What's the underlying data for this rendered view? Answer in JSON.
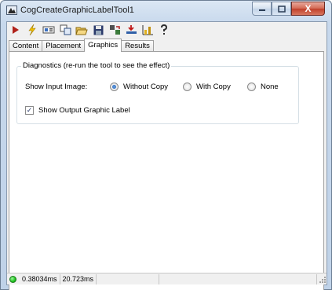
{
  "window": {
    "title": "CogCreateGraphicLabelTool1",
    "minimize_icon": "minimize-icon",
    "maximize_icon": "maximize-icon",
    "close_label": "X"
  },
  "toolbar": {
    "items": [
      "run-icon",
      "run-continuous-icon",
      "display-icon",
      "copy-icon",
      "open-icon",
      "save-icon",
      "reset-icon",
      "import-icon",
      "chart-icon",
      "help-icon"
    ]
  },
  "tabs": [
    {
      "label": "Content",
      "active": false
    },
    {
      "label": "Placement",
      "active": false
    },
    {
      "label": "Graphics",
      "active": true
    },
    {
      "label": "Results",
      "active": false
    }
  ],
  "diagnostics": {
    "legend": "Diagnostics (re-run the tool to see the effect)",
    "show_input_label": "Show Input Image:",
    "options": [
      {
        "label": "Without Copy",
        "selected": true
      },
      {
        "label": "With Copy",
        "selected": false
      },
      {
        "label": "None",
        "selected": false
      }
    ],
    "show_output_label": "Show Output Graphic Label",
    "show_output_checked": true
  },
  "status": {
    "led_color": "#1ec31e",
    "time1": "0.38034ms",
    "time2": "20.723ms"
  }
}
